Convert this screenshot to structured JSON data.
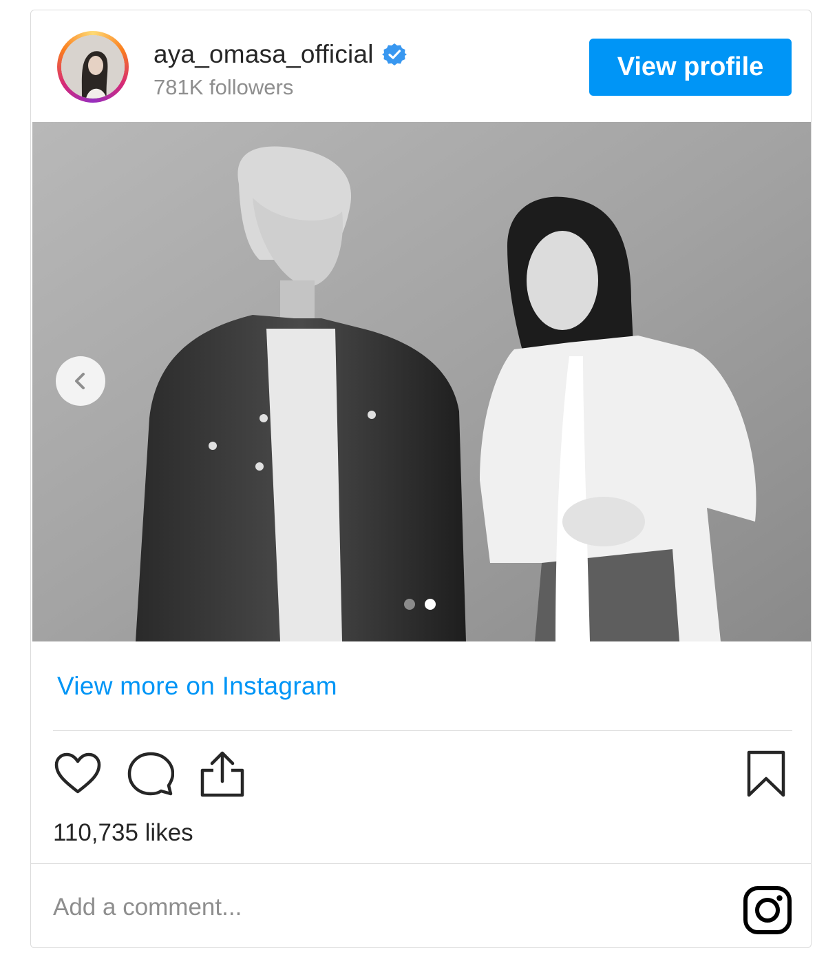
{
  "header": {
    "username": "aya_omasa_official",
    "followers": "781K followers",
    "view_profile_label": "View profile",
    "verified": true
  },
  "post": {
    "image_description_icon": "photo",
    "carousel": {
      "current": 2,
      "total": 2
    }
  },
  "links": {
    "view_more": "View more on Instagram"
  },
  "engagement": {
    "likes": "110,735 likes"
  },
  "comment": {
    "placeholder": "Add a comment..."
  },
  "icons": [
    "heart-icon",
    "comment-icon",
    "share-icon",
    "bookmark-icon",
    "instagram-logo-icon",
    "verified-badge-icon",
    "chevron-left-icon"
  ],
  "colors": {
    "accent": "#0095f6",
    "text": "#262626",
    "muted": "#8e8e8e",
    "border": "#dbdbdb"
  }
}
